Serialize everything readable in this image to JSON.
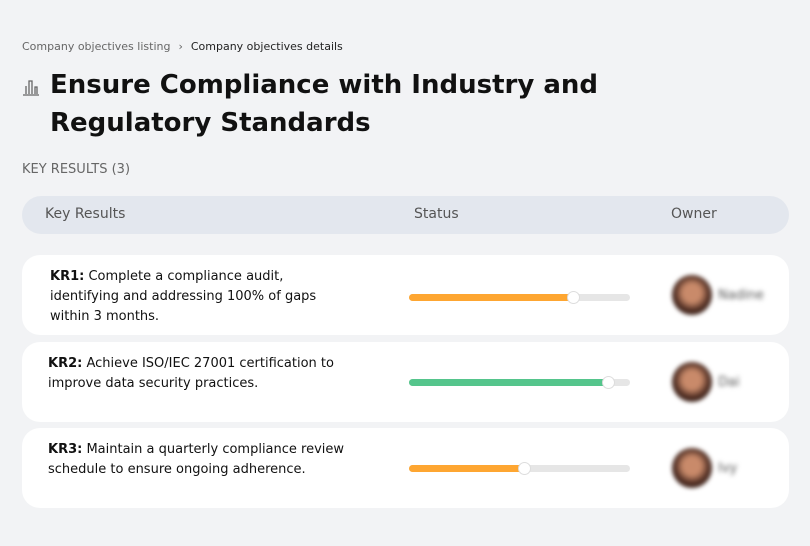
{
  "breadcrumb": {
    "items": [
      "Company objectives listing",
      "Company objectives details"
    ]
  },
  "page": {
    "title": "Ensure Compliance with Industry and Regulatory Standards",
    "icon": "bar-chart-icon"
  },
  "key_results_label": "KEY RESULTS (3)",
  "table": {
    "headers": [
      "Key Results",
      "Status",
      "Owner"
    ],
    "rows": [
      {
        "id": "KR1:",
        "text": " Complete a compliance audit, identifying and addressing 100% of gaps within 3 months.",
        "progress": 74,
        "color": "#fea631",
        "owner": "Nadine"
      },
      {
        "id": "KR2:",
        "text": " Achieve ISO/IEC 27001 certification to improve data security practices.",
        "progress": 90,
        "color": "#55c58c",
        "owner": "Dai"
      },
      {
        "id": "KR3:",
        "text": " Maintain a quarterly compliance review schedule to ensure ongoing adherence.",
        "progress": 52,
        "color": "#fea631",
        "owner": "Ivy"
      }
    ]
  }
}
